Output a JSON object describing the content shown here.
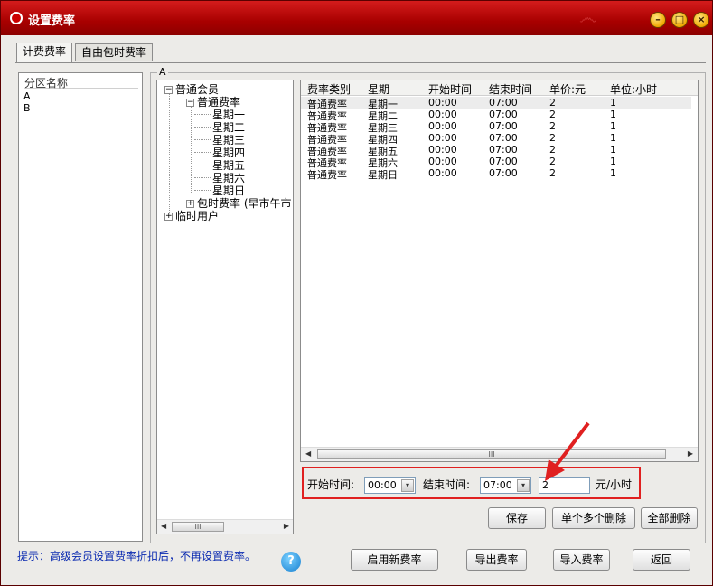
{
  "window": {
    "title": "设置费率"
  },
  "tabs": [
    {
      "label": "计费费率"
    },
    {
      "label": "自由包时费率"
    }
  ],
  "zone_list": {
    "header": "分区名称",
    "items": [
      "A",
      "B"
    ]
  },
  "selected_zone_label": "A",
  "tree": {
    "nodes": [
      {
        "label": "普通会员",
        "toggle": "−"
      },
      {
        "label": "普通费率",
        "toggle": "−"
      },
      {
        "label": "星期一"
      },
      {
        "label": "星期二"
      },
      {
        "label": "星期三"
      },
      {
        "label": "星期四"
      },
      {
        "label": "星期五"
      },
      {
        "label": "星期六"
      },
      {
        "label": "星期日"
      },
      {
        "label": "包时费率 (早市午市",
        "toggle": "+"
      },
      {
        "label": "临时用户",
        "toggle": "+"
      }
    ]
  },
  "rate_table": {
    "columns": [
      "费率类别",
      "星期",
      "开始时间",
      "结束时间",
      "单价:元",
      "单位:小时"
    ],
    "rows": [
      [
        "普通费率",
        "星期一",
        "00:00",
        "07:00",
        "2",
        "1"
      ],
      [
        "普通费率",
        "星期二",
        "00:00",
        "07:00",
        "2",
        "1"
      ],
      [
        "普通费率",
        "星期三",
        "00:00",
        "07:00",
        "2",
        "1"
      ],
      [
        "普通费率",
        "星期四",
        "00:00",
        "07:00",
        "2",
        "1"
      ],
      [
        "普通费率",
        "星期五",
        "00:00",
        "07:00",
        "2",
        "1"
      ],
      [
        "普通费率",
        "星期六",
        "00:00",
        "07:00",
        "2",
        "1"
      ],
      [
        "普通费率",
        "星期日",
        "00:00",
        "07:00",
        "2",
        "1"
      ]
    ]
  },
  "editor": {
    "start_label": "开始时间:",
    "start_value": "00:00",
    "end_label": "结束时间:",
    "end_value": "07:00",
    "price_value": "2",
    "unit_label": "元/小时"
  },
  "actions": {
    "save": "保存",
    "delete_selected": "单个多个删除",
    "delete_all": "全部删除"
  },
  "footer": {
    "hint": "提示：高级会员设置费率折扣后，不再设置费率。",
    "help": "?",
    "enable_new": "启用新费率",
    "export": "导出费率",
    "import": "导入费率",
    "back": "返回"
  },
  "scrollbar_glyph": "III",
  "colors": {
    "titlebar": "#c00000",
    "highlight": "#e02020",
    "hint": "#0a2ab0"
  }
}
